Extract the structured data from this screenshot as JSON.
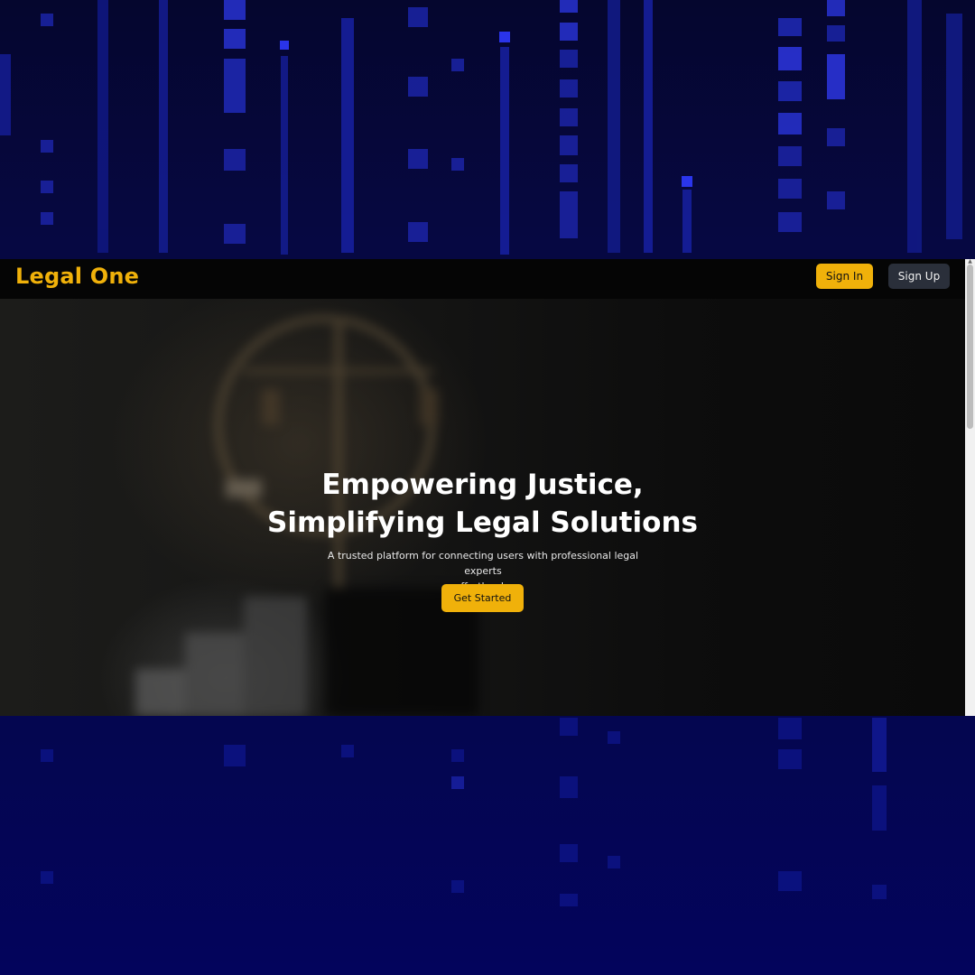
{
  "navbar": {
    "brand": "Legal One",
    "signin_label": "Sign In",
    "signup_label": "Sign Up"
  },
  "hero": {
    "title_line1": "Empowering Justice,",
    "title_line2": "Simplifying Legal Solutions",
    "subtitle_line1": "A trusted platform for connecting users with professional legal experts",
    "subtitle_line2": "effortlessly.",
    "cta_label": "Get Started"
  },
  "colors": {
    "accent": "#f0b10a",
    "navbar_bg": "#050505",
    "signup_bg": "#2a2f3a",
    "backdrop": "#03045a"
  },
  "icons": {
    "scroll_up": "scroll-up-arrow-icon"
  }
}
